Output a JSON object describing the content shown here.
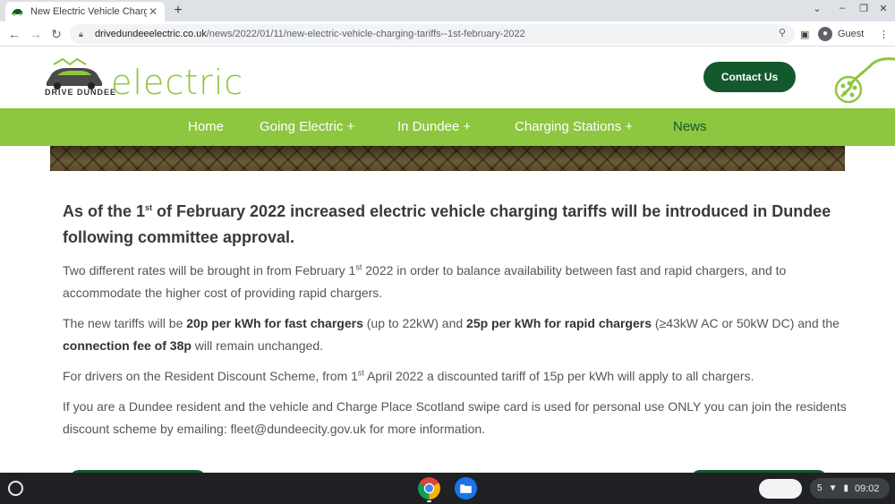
{
  "browser": {
    "tab_title": "New Electric Vehicle Charging Ta",
    "tab_close": "✕",
    "new_tab": "+",
    "url_host": "drivedundeeelectric.co.uk",
    "url_path": "/news/2022/01/11/new-electric-vehicle-charging-tariffs--1st-february-2022",
    "profile_label": "Guest",
    "icons": [
      "back-arrow-icon",
      "forward-arrow-icon",
      "reload-icon",
      "lock-icon",
      "zoom-icon",
      "sidepanel-icon",
      "profile-icon",
      "kebab-menu-icon"
    ]
  },
  "site": {
    "logo_small": "DRIVE DUNDEE",
    "logo_big": "electric",
    "contact_label": "Contact Us",
    "brand_green": "#8dc63f",
    "dark_green": "#14592e",
    "nav": [
      {
        "label": "Home"
      },
      {
        "label": "Going Electric +"
      },
      {
        "label": "In Dundee +"
      },
      {
        "label": "Charging Stations +"
      },
      {
        "label": "News"
      }
    ]
  },
  "article": {
    "headline_pre": "As of the 1",
    "headline_sup": "st",
    "headline_post": " of February 2022  increased electric vehicle charging tariffs will be introduced in Dundee following committee approval.",
    "p1_pre": "Two different rates will be brought in from February 1",
    "p1_sup": "st",
    "p1_post": "  2022 in order to balance availability between fast and rapid chargers, and to accommodate the higher cost of providing rapid chargers.",
    "p2_a": "The new tariffs will be ",
    "p2_b": "20p per kWh for fast chargers",
    "p2_c": " (up to 22kW) and ",
    "p2_d": "25p per kWh for rapid chargers",
    "p2_e": " (≥43kW AC or 50kW DC) and the ",
    "p2_f": "connection fee of 38p",
    "p2_g": " will remain unchanged.",
    "p3_pre": "For drivers on the Resident Discount Scheme, from 1",
    "p3_sup": "st",
    "p3_post": " April 2022 a discounted tariff of 15p per kWh will apply to all chargers.",
    "p4": "If you are a Dundee resident and the vehicle and Charge Place Scotland swipe card is used for personal use ONLY you can join the residents discount scheme by emailing: fleet@dundeecity.gov.uk for more information."
  },
  "shelf": {
    "time": "09:02",
    "notification_count": "5"
  }
}
